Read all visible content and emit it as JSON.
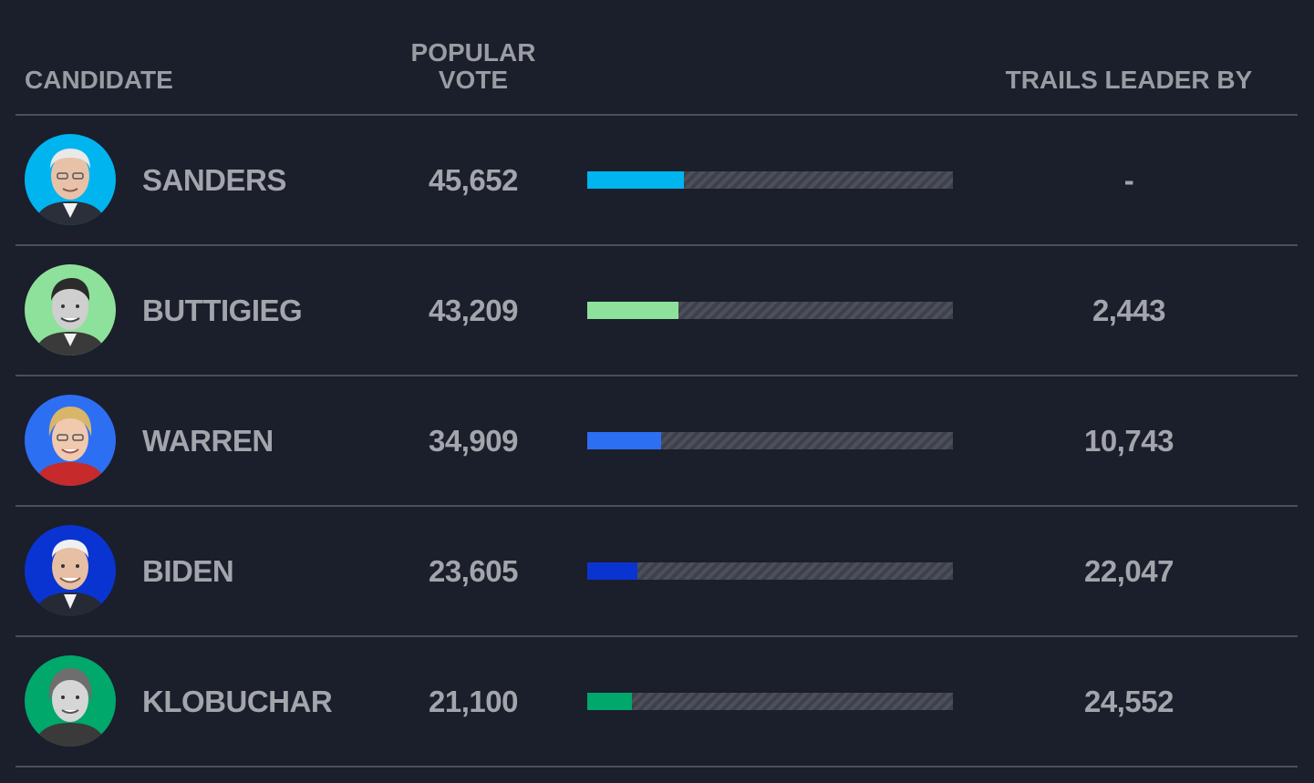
{
  "header": {
    "candidate": "CANDIDATE",
    "vote_line1": "POPULAR",
    "vote_line2": "VOTE",
    "trails": "TRAILS LEADER BY"
  },
  "rows": [
    {
      "name": "SANDERS",
      "votes": "45,652",
      "trails": "-",
      "color": "#00b4f0"
    },
    {
      "name": "BUTTIGIEG",
      "votes": "43,209",
      "trails": "2,443",
      "color": "#8ee19a"
    },
    {
      "name": "WARREN",
      "votes": "34,909",
      "trails": "10,743",
      "color": "#2d6ff2"
    },
    {
      "name": "BIDEN",
      "votes": "23,605",
      "trails": "22,047",
      "color": "#0a34d1"
    },
    {
      "name": "KLOBUCHAR",
      "votes": "21,100",
      "trails": "24,552",
      "color": "#00a86b"
    }
  ],
  "chart_data": {
    "type": "bar",
    "categories": [
      "SANDERS",
      "BUTTIGIEG",
      "WARREN",
      "BIDEN",
      "KLOBUCHAR"
    ],
    "values": [
      45652,
      43209,
      34909,
      23605,
      21100
    ],
    "trails_leader_by": [
      "-",
      "2,443",
      "10,743",
      "22,047",
      "24,552"
    ],
    "bar_fraction": [
      0.265,
      0.25,
      0.202,
      0.137,
      0.122
    ],
    "colors": [
      "#00b4f0",
      "#8ee19a",
      "#2d6ff2",
      "#0a34d1",
      "#00a86b"
    ],
    "grid": false
  }
}
